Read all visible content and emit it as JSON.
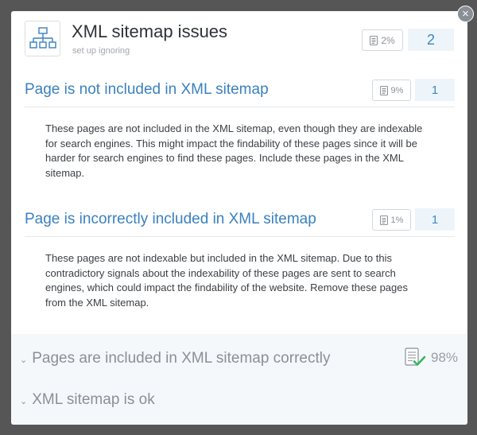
{
  "header": {
    "title": "XML sitemap issues",
    "subtitle": "set up ignoring",
    "percent": "2%",
    "count": "2"
  },
  "issues": [
    {
      "title": "Page is not included in XML sitemap",
      "percent": "9%",
      "count": "1",
      "description": "These pages are not included in the XML sitemap, even though they are indexable for search engines. This might impact the findability of these pages since it will be harder for search engines to find these pages. Include these pages in the XML sitemap."
    },
    {
      "title": "Page is incorrectly included in XML sitemap",
      "percent": "1%",
      "count": "1",
      "description": "These pages are not indexable but included in the XML sitemap. Due to this contradictory signals about the indexability of these pages are sent to search engines, which could impact the findability of the website. Remove these pages from the XML sitemap."
    }
  ],
  "ok_sections": [
    {
      "label": "Pages are included in XML sitemap correctly",
      "percent": "98%"
    },
    {
      "label": "XML sitemap is ok"
    }
  ],
  "icons": {
    "close": "close-icon",
    "header": "sitemap-icon",
    "badge": "document-icon",
    "ok": "document-check-icon",
    "chevron": "chevron-down-icon"
  },
  "colors": {
    "accent": "#3a81bf",
    "count_bg": "#edf5fa",
    "success": "#2fb85c"
  }
}
